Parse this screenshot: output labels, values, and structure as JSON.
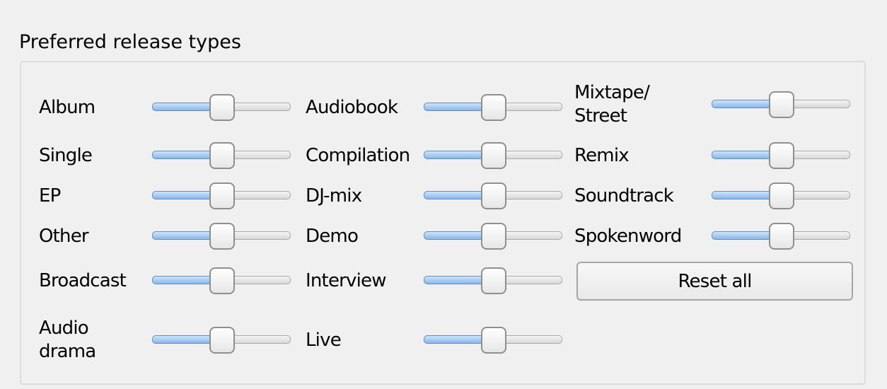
{
  "group_title": "Preferred release types",
  "reset_label": "Reset all",
  "colors": {
    "slider_fill": "#8ab8e8",
    "slider_fill_border": "#5c8fc6",
    "groove": "#dcdcdc",
    "background": "#f0f0f0"
  },
  "slider_level": 0.5,
  "columns": [
    {
      "items": [
        {
          "label": "Album",
          "value": 0.5
        },
        {
          "label": "Single",
          "value": 0.5
        },
        {
          "label": "EP",
          "value": 0.5
        },
        {
          "label": "Other",
          "value": 0.5
        },
        {
          "label": "Broadcast",
          "value": 0.5
        },
        {
          "label": "Audio\ndrama",
          "value": 0.5
        }
      ]
    },
    {
      "items": [
        {
          "label": "Audiobook",
          "value": 0.5
        },
        {
          "label": "Compilation",
          "value": 0.5
        },
        {
          "label": "DJ-mix",
          "value": 0.5
        },
        {
          "label": "Demo",
          "value": 0.5
        },
        {
          "label": "Interview",
          "value": 0.5
        },
        {
          "label": "Live",
          "value": 0.5
        }
      ]
    },
    {
      "items": [
        {
          "label": "Mixtape/\nStreet",
          "value": 0.5
        },
        {
          "label": "Remix",
          "value": 0.5
        },
        {
          "label": "Soundtrack",
          "value": 0.5
        },
        {
          "label": "Spokenword",
          "value": 0.5
        }
      ]
    }
  ]
}
